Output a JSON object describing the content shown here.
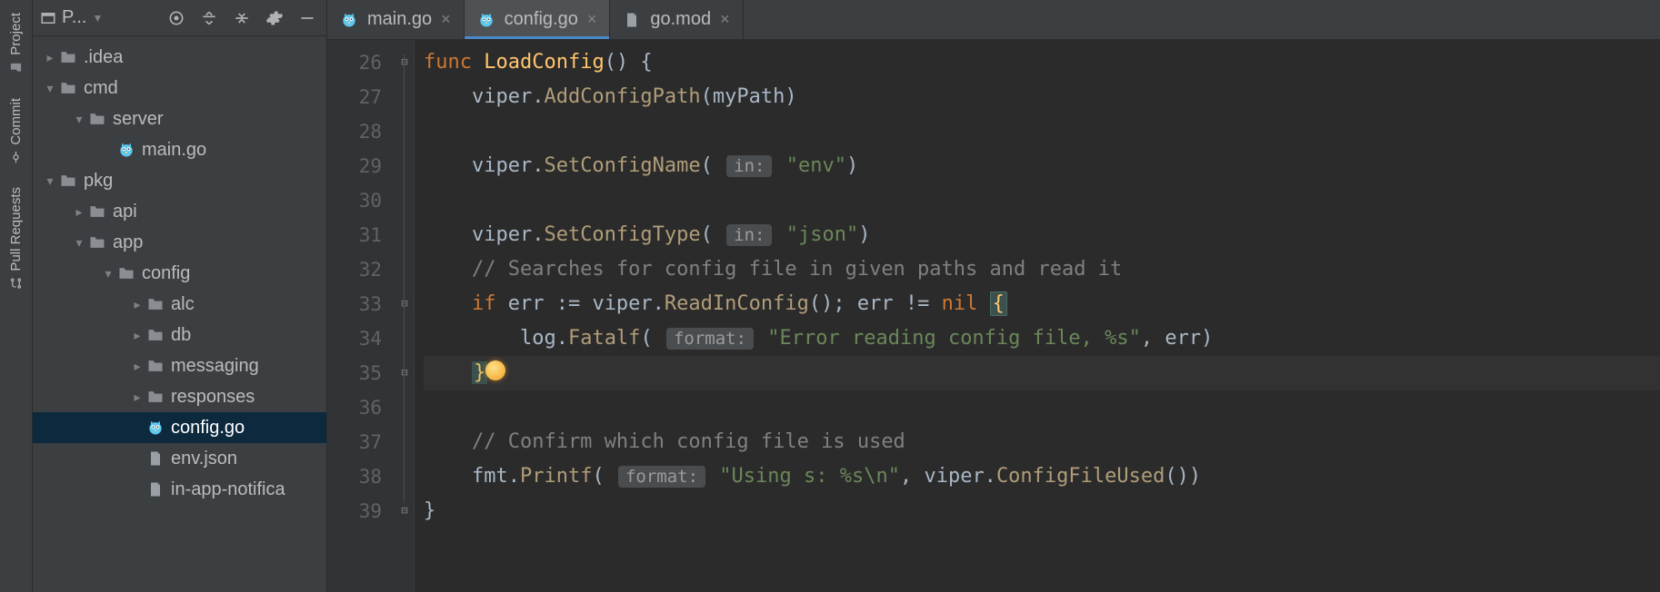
{
  "rail": {
    "project": "Project",
    "commit": "Commit",
    "pull": "Pull Requests"
  },
  "panel": {
    "title": "P..."
  },
  "tree": [
    {
      "depth": 0,
      "arrow": "right",
      "icon": "folder",
      "label": ".idea"
    },
    {
      "depth": 0,
      "arrow": "down",
      "icon": "folder",
      "label": "cmd"
    },
    {
      "depth": 1,
      "arrow": "down",
      "icon": "folder",
      "label": "server"
    },
    {
      "depth": 2,
      "arrow": "none",
      "icon": "go",
      "label": "main.go"
    },
    {
      "depth": 0,
      "arrow": "down",
      "icon": "folder",
      "label": "pkg"
    },
    {
      "depth": 1,
      "arrow": "right",
      "icon": "folder",
      "label": "api"
    },
    {
      "depth": 1,
      "arrow": "down",
      "icon": "folder",
      "label": "app"
    },
    {
      "depth": 2,
      "arrow": "down",
      "icon": "folder",
      "label": "config"
    },
    {
      "depth": 3,
      "arrow": "right",
      "icon": "folder",
      "label": "alc"
    },
    {
      "depth": 3,
      "arrow": "right",
      "icon": "folder",
      "label": "db"
    },
    {
      "depth": 3,
      "arrow": "right",
      "icon": "folder",
      "label": "messaging"
    },
    {
      "depth": 3,
      "arrow": "right",
      "icon": "folder",
      "label": "responses"
    },
    {
      "depth": 3,
      "arrow": "none",
      "icon": "go",
      "label": "config.go",
      "selected": true
    },
    {
      "depth": 3,
      "arrow": "none",
      "icon": "file",
      "label": "env.json"
    },
    {
      "depth": 3,
      "arrow": "none",
      "icon": "file",
      "label": "in-app-notifica"
    }
  ],
  "tabs": [
    {
      "icon": "go",
      "label": "main.go",
      "active": false
    },
    {
      "icon": "go",
      "label": "config.go",
      "active": true
    },
    {
      "icon": "file",
      "label": "go.mod",
      "active": false
    }
  ],
  "lines": [
    "26",
    "27",
    "28",
    "29",
    "30",
    "31",
    "32",
    "33",
    "34",
    "35",
    "36",
    "37",
    "38",
    "39"
  ],
  "code": {
    "l26": {
      "func": "func",
      "name": "LoadConfig",
      "rest": "() {"
    },
    "l27": {
      "pre": "    viper.",
      "call": "AddConfigPath",
      "rest": "(myPath)"
    },
    "l29": {
      "pre": "    viper.",
      "call": "SetConfigName",
      "open": "(",
      "hint": "in:",
      "str": "\"env\"",
      "close": ")"
    },
    "l31": {
      "pre": "    viper.",
      "call": "SetConfigType",
      "open": "(",
      "hint": "in:",
      "str": "\"json\"",
      "close": ")"
    },
    "l32": "    // Searches for config file in given paths and read it",
    "l33": {
      "indent": "    ",
      "if": "if",
      "sp1": " err := viper.",
      "call": "ReadInConfig",
      "mid": "(); err != ",
      "nil": "nil",
      "sp2": " ",
      "brace": "{"
    },
    "l34": {
      "pre": "        log.",
      "call": "Fatalf",
      "open": "(",
      "hint": "format:",
      "str": "\"Error reading config file, %s\"",
      "rest": ", err)"
    },
    "l35": {
      "indent": "    ",
      "brace": "}"
    },
    "l37": "    // Confirm which config file is used",
    "l38": {
      "pre": "    fmt.",
      "call": "Printf",
      "open": "(",
      "hint": "format:",
      "str": "\"Using s: %s\\n\"",
      "rest": ", viper.",
      "call2": "ConfigFileUsed",
      "close": "())"
    },
    "l39": "}"
  }
}
